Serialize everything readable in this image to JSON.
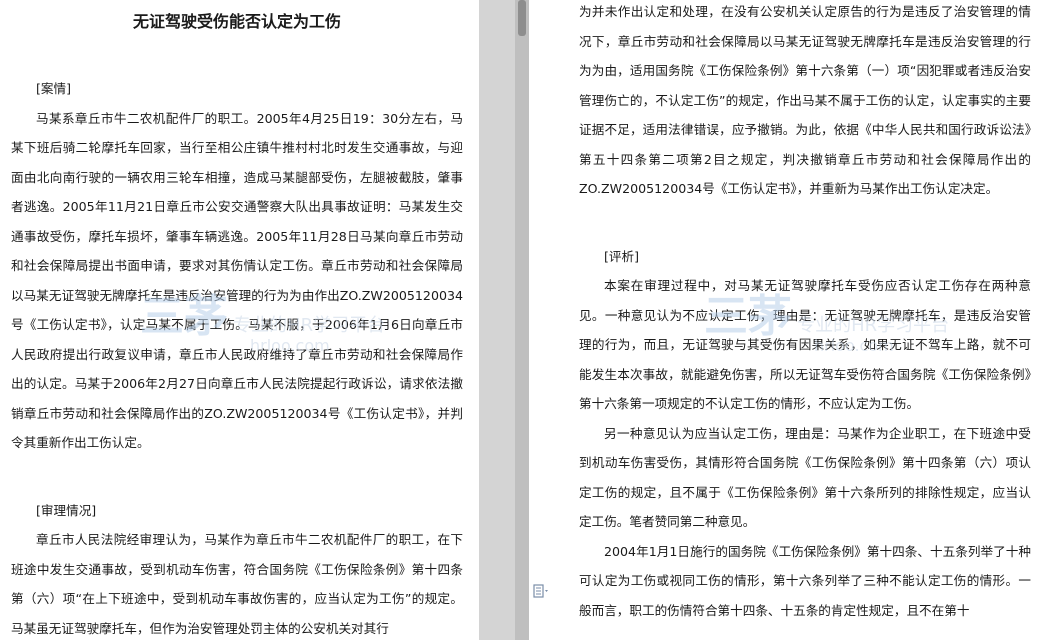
{
  "left_page": {
    "title": "无证驾驶受伤能否认定为工伤",
    "paragraphs": [
      {
        "kind": "head",
        "text": "[案情]"
      },
      {
        "kind": "body",
        "text": "马某系章丘市牛二农机配件厂的职工。2005年4月25日19：30分左右，马某下班后骑二轮摩托车回家，当行至相公庄镇牛推村村北时发生交通事故，与迎面由北向南行驶的一辆农用三轮车相撞，造成马某腿部受伤，左腿被截肢，肇事者逃逸。2005年11月21日章丘市公安交通警察大队出具事故证明：马某发生交通事故受伤，摩托车损坏，肇事车辆逃逸。2005年11月28日马某向章丘市劳动和社会保障局提出书面申请，要求对其伤情认定工伤。章丘市劳动和社会保障局以马某无证驾驶无牌摩托车是违反治安管理的行为为由作出ZO.ZW2005120034号《工伤认定书》，认定马某不属于工伤。马某不服，于2006年1月6日向章丘市人民政府提出行政复议申请，章丘市人民政府维持了章丘市劳动和社会保障局作出的认定。马某于2006年2月27日向章丘市人民法院提起行政诉讼，请求依法撤销章丘市劳动和社会保障局作出的ZO.ZW2005120034号《工伤认定书》，并判令其重新作出工伤认定。"
      },
      {
        "kind": "head",
        "text": "[审理情况]"
      },
      {
        "kind": "body",
        "text": "章丘市人民法院经审理认为，马某作为章丘市牛二农机配件厂的职工，在下班途中发生交通事故，受到机动车伤害，符合国务院《工伤保险条例》第十四条第（六）项“在上下班途中，受到机动车事故伤害的，应当认定为工伤”的规定。马某虽无证驾驶摩托车，但作为治安管理处罚主体的公安机关对其行"
      }
    ]
  },
  "right_page": {
    "paragraphs": [
      {
        "kind": "cont",
        "text": "为并未作出认定和处理，在没有公安机关认定原告的行为是违反了治安管理的情况下，章丘市劳动和社会保障局以马某无证驾驶无牌摩托车是违反治安管理的行为为由，适用国务院《工伤保险条例》第十六条第（一）项“因犯罪或者违反治安管理伤亡的，不认定工伤”的规定，作出马某不属于工伤的认定，认定事实的主要证据不足，适用法律错误，应予撤销。为此，依据《中华人民共和国行政诉讼法》第五十四条第二项第2目之规定，判决撤销章丘市劳动和社会保障局作出的ZO.ZW2005120034号《工伤认定书》，并重新为马某作出工伤认定决定。"
      },
      {
        "kind": "head",
        "text": "[评析]"
      },
      {
        "kind": "body",
        "text": "本案在审理过程中，对马某无证驾驶摩托车受伤应否认定工伤存在两种意见。一种意见认为不应认定工伤，理由是：无证驾驶无牌摩托车，是违反治安管理的行为，而且，无证驾驶与其受伤有因果关系，如果无证不驾车上路，就不可能发生本次事故，就能避免伤害，所以无证驾车受伤符合国务院《工伤保险条例》第十六条第一项规定的不认定工伤的情形，不应认定为工伤。"
      },
      {
        "kind": "body",
        "text": "另一种意见认为应当认定工伤，理由是：马某作为企业职工，在下班途中受到机动车伤害受伤，其情形符合国务院《工伤保险条例》第十四条第（六）项认定工伤的规定，且不属于《工伤保险条例》第十六条所列的排除性规定，应当认定工伤。笔者赞同第二种意见。"
      },
      {
        "kind": "body",
        "text": "2004年1月1日施行的国务院《工伤保险条例》第十四条、十五条列举了十种可认定为工伤或视同工伤的情形，第十六条列举了三种不能认定工伤的情形。一般而言，职工的伤情符合第十四条、十五条的肯定性规定，且不在第十"
      }
    ]
  },
  "watermark": {
    "logo": "三茅",
    "slogan": "专业的HR学习平台",
    "url": "hrloo.com"
  },
  "colors": {
    "watermark": "#c9d6e6",
    "page": "#ffffff",
    "background": "#d9d9d9"
  },
  "icons": {
    "document": "document-icon"
  }
}
